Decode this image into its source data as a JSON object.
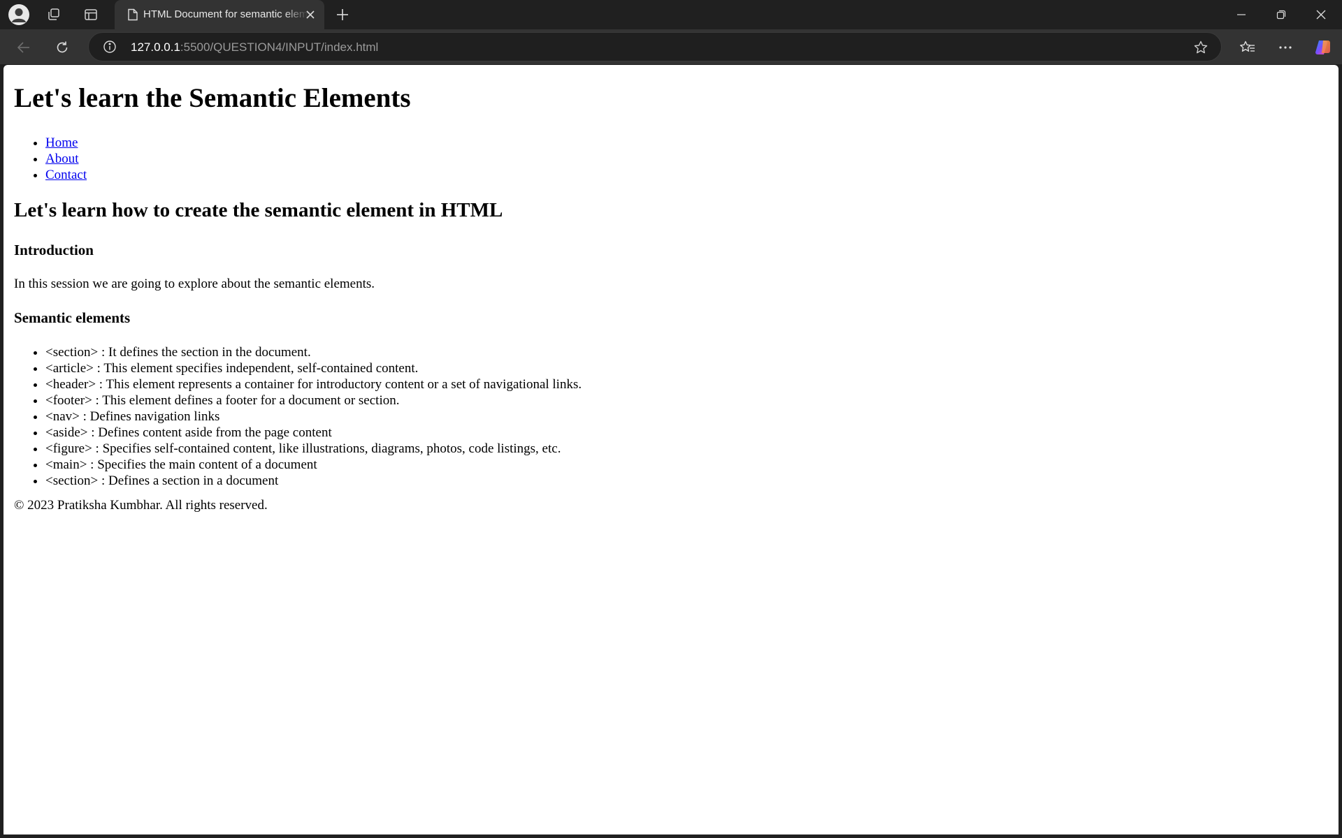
{
  "browser": {
    "tab_title": "HTML Document for semantic elements",
    "url_host": "127.0.0.1",
    "url_rest": ":5500/QUESTION4/INPUT/index.html"
  },
  "page": {
    "h1": "Let's learn the Semantic Elements",
    "nav": [
      "Home",
      "About",
      "Contact"
    ],
    "h2": "Let's learn how to create the semantic element in HTML",
    "intro_heading": "Introduction",
    "intro_text": "In this session we are going to explore about the semantic elements.",
    "semantic_heading": "Semantic elements",
    "semantic_items": [
      "<section> : It defines the section in the document.",
      "<article> : This element specifies independent, self-contained content.",
      "<header> : This element represents a container for introductory content or a set of navigational links.",
      "<footer> : This element defines a footer for a document or section.",
      "<nav> : Defines navigation links",
      "<aside> : Defines content aside from the page content",
      "<figure> : Specifies self-contained content, like illustrations, diagrams, photos, code listings, etc.",
      "<main> : Specifies the main content of a document",
      "<section> : Defines a section in a document"
    ],
    "footer": "© 2023 Pratiksha Kumbhar. All rights reserved."
  }
}
